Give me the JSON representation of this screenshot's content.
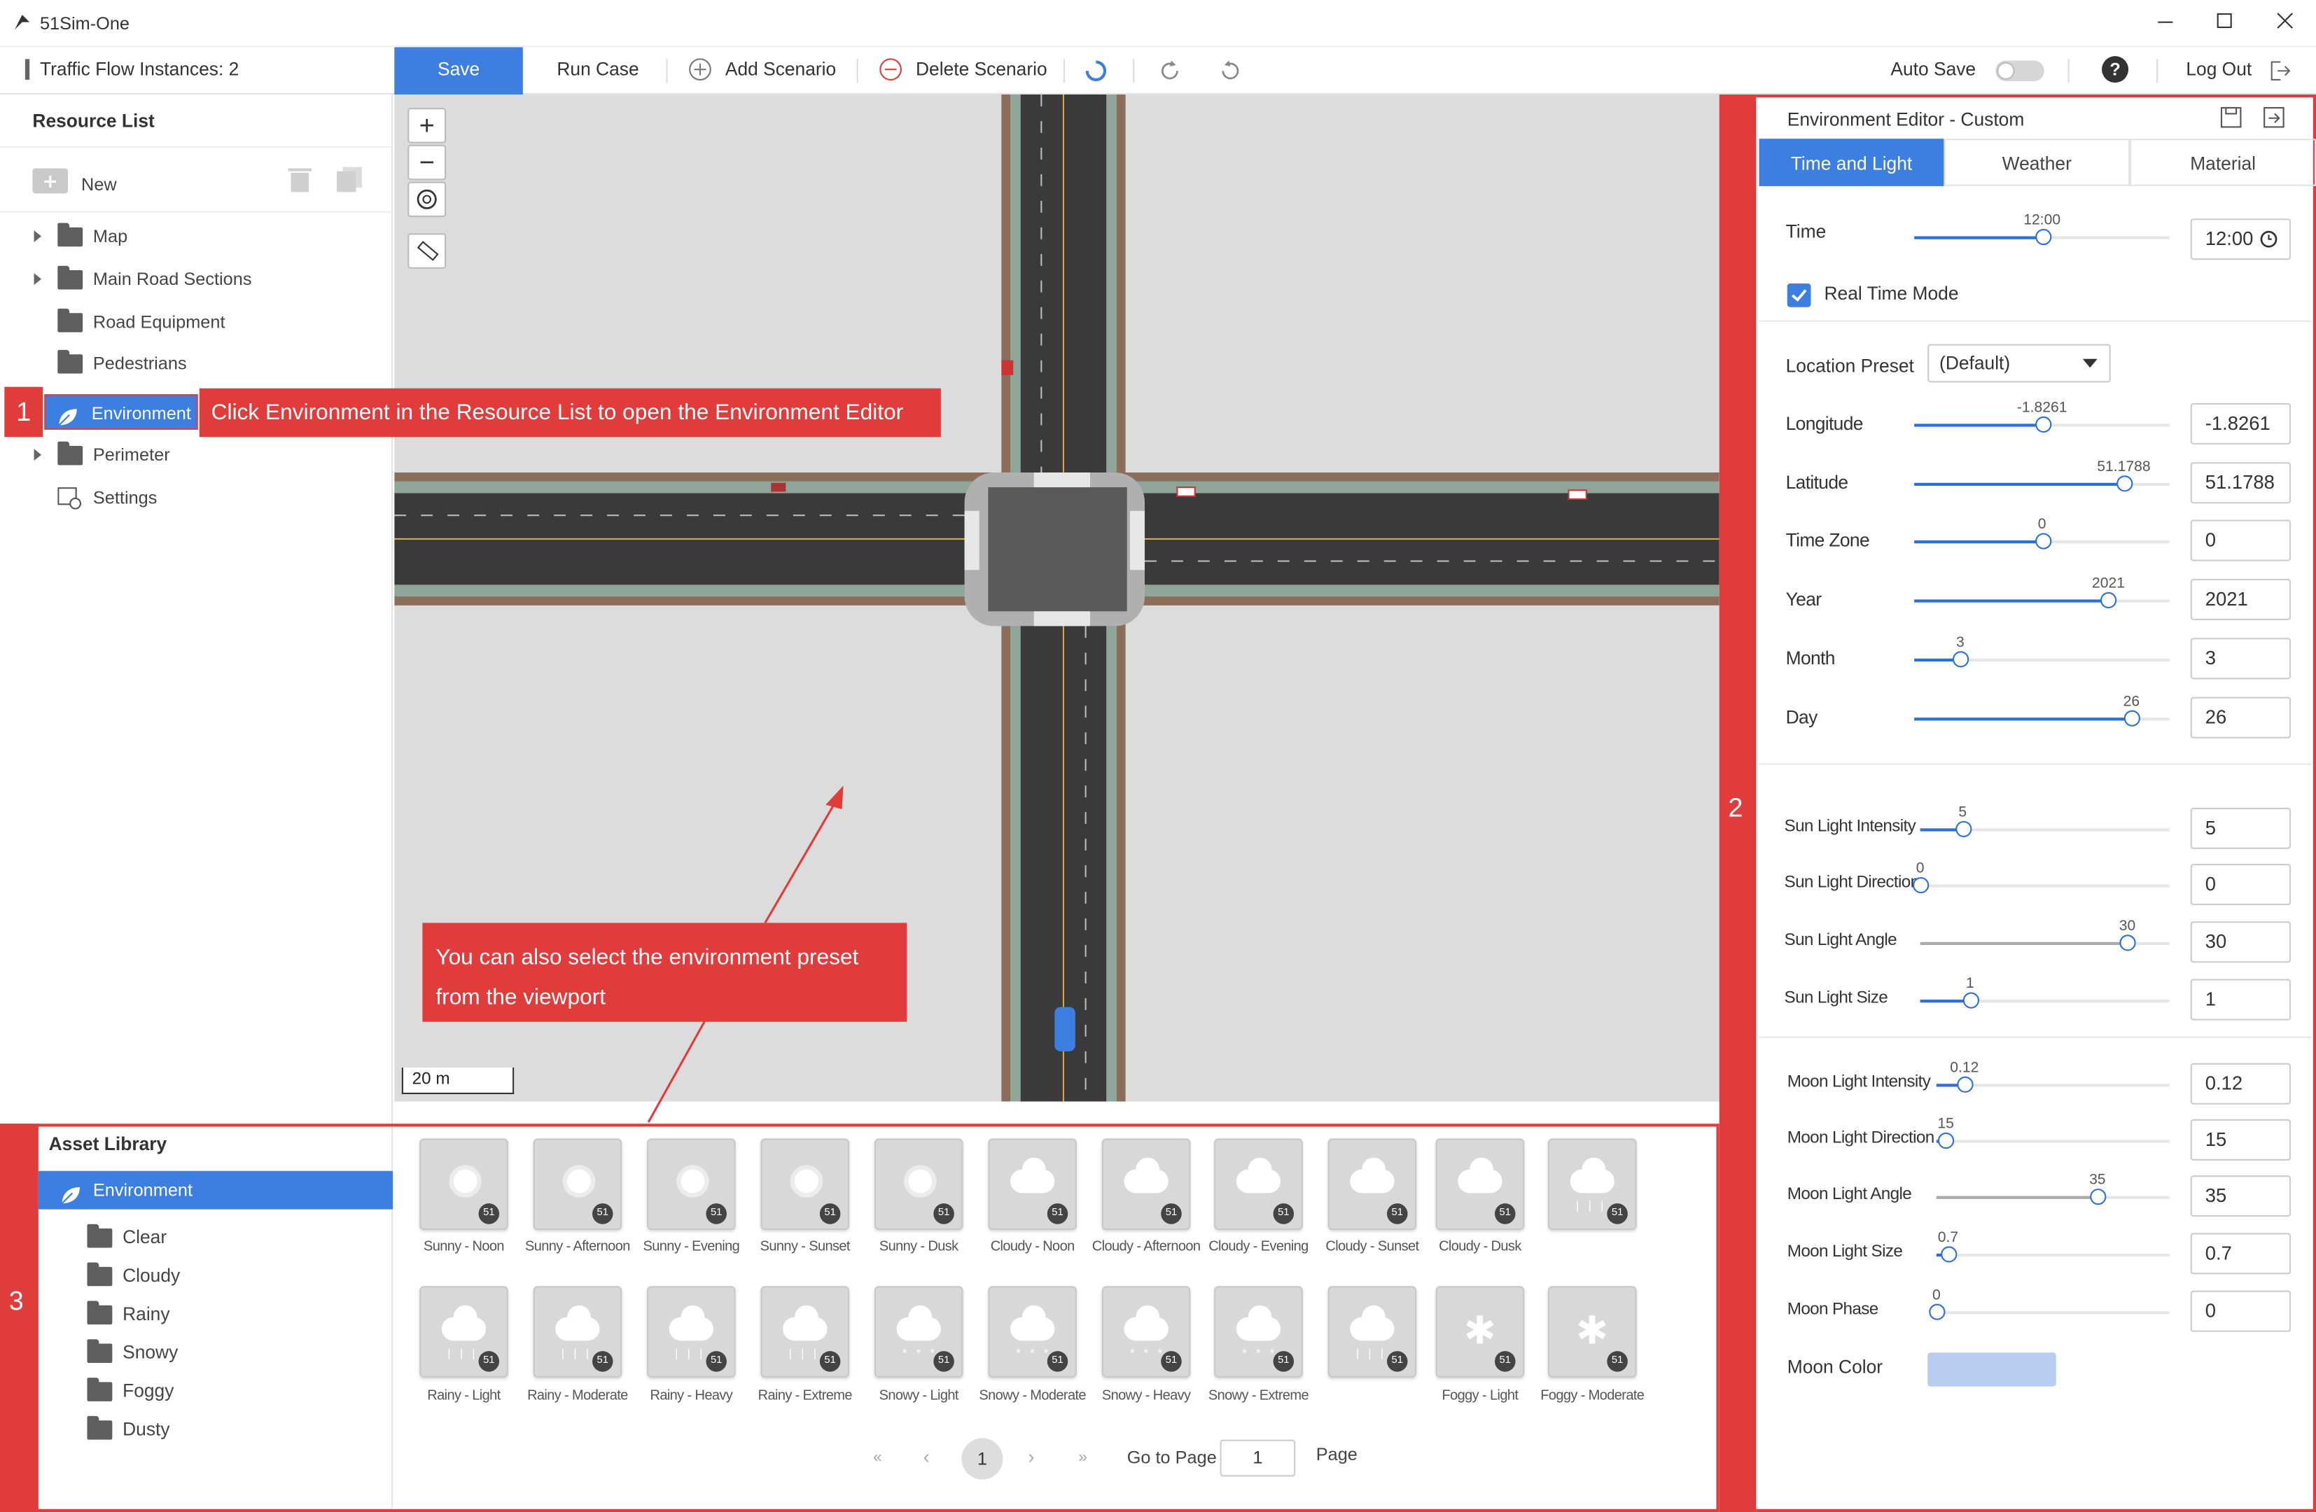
{
  "app": {
    "title": "51Sim-One"
  },
  "toolbar": {
    "traffic_label": "Traffic Flow Instances: 2",
    "save": "Save",
    "run_case": "Run Case",
    "add_scenario": "Add Scenario",
    "delete_scenario": "Delete Scenario",
    "auto_save": "Auto Save",
    "log_out": "Log Out",
    "help": "?"
  },
  "resource_list": {
    "title": "Resource List",
    "new": "New",
    "items": [
      {
        "label": "Map"
      },
      {
        "label": "Main Road Sections"
      },
      {
        "label": "Road Equipment"
      },
      {
        "label": "Pedestrians"
      },
      {
        "label": "Environment"
      },
      {
        "label": "Perimeter"
      },
      {
        "label": "Settings"
      }
    ]
  },
  "annotations": {
    "step1_num": "1",
    "step1_text": "Click Environment in the Resource List to open the Environment Editor",
    "step2_num": "2",
    "step3_num": "3",
    "viewport_line1": "You can also select the environment preset",
    "viewport_line2": "from the viewport"
  },
  "viewport": {
    "scale": "20 m",
    "zoom_in": "+",
    "zoom_out": "−"
  },
  "env_editor": {
    "title": "Environment Editor - Custom",
    "tabs": [
      "Time and Light",
      "Weather",
      "Material"
    ],
    "active_tab": "Time and Light",
    "time": {
      "label": "Time",
      "value": "12:00",
      "slider_label": "12:00",
      "fraction": 0.5
    },
    "real_time_mode": {
      "label": "Real Time Mode",
      "checked": true
    },
    "location_preset": {
      "label": "Location Preset",
      "value": "(Default)"
    },
    "location": [
      {
        "label": "Longitude",
        "value": "-1.8261",
        "fraction": 0.5
      },
      {
        "label": "Latitude",
        "value": "51.1788",
        "fraction": 0.82
      },
      {
        "label": "Time Zone",
        "value": "0",
        "fraction": 0.5
      },
      {
        "label": "Year",
        "value": "2021",
        "fraction": 0.76
      },
      {
        "label": "Month",
        "value": "3",
        "fraction": 0.18
      },
      {
        "label": "Day",
        "value": "26",
        "fraction": 0.85
      }
    ],
    "sun": [
      {
        "label": "Sun Light Intensity",
        "value": "5",
        "fraction": 0.17
      },
      {
        "label": "Sun Light Direction",
        "value": "0",
        "fraction": 0.0
      },
      {
        "label": "Sun Light Angle",
        "value": "30",
        "fraction": 0.83
      },
      {
        "label": "Sun Light Size",
        "value": "1",
        "fraction": 0.2
      }
    ],
    "moon": [
      {
        "label": "Moon Light Intensity",
        "value": "0.12",
        "fraction": 0.12
      },
      {
        "label": "Moon Light Direction",
        "value": "15",
        "fraction": 0.04
      },
      {
        "label": "Moon Light Angle",
        "value": "35",
        "fraction": 0.69
      },
      {
        "label": "Moon Light Size",
        "value": "0.7",
        "fraction": 0.05
      },
      {
        "label": "Moon Phase",
        "value": "0",
        "fraction": 0.0
      }
    ],
    "moon_color": {
      "label": "Moon Color",
      "color": "#b9cdf0"
    }
  },
  "asset_library": {
    "title": "Asset Library",
    "root": "Environment",
    "categories": [
      "Clear",
      "Cloudy",
      "Rainy",
      "Snowy",
      "Foggy",
      "Dusty"
    ],
    "badge": "51",
    "row1": [
      "Sunny - Noon",
      "Sunny - Afternoon",
      "Sunny - Evening",
      "Sunny - Sunset",
      "Sunny - Dusk",
      "Cloudy - Noon",
      "Cloudy - Afternoon",
      "Cloudy - Evening",
      "Cloudy - Sunset",
      "Cloudy - Dusk",
      ""
    ],
    "row2": [
      "Rainy - Light",
      "Rainy - Moderate",
      "Rainy - Heavy",
      "Rainy - Extreme",
      "Snowy - Light",
      "Snowy - Moderate",
      "Snowy - Heavy",
      "Snowy - Extreme",
      "",
      "Foggy - Light",
      "Foggy - Moderate"
    ],
    "pagination": {
      "current": "1",
      "go_to": "Go to Page",
      "input": "1",
      "suffix": "Page"
    }
  },
  "colors": {
    "accent": "#3d7fe0",
    "annotation": "#e03c3c"
  }
}
